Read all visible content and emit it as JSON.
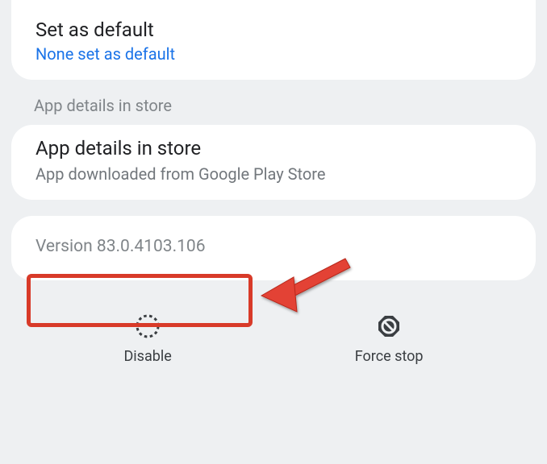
{
  "default": {
    "title": "Set as default",
    "subtitle": "None set as default"
  },
  "sectionHeader": "App details in store",
  "storeDetails": {
    "title": "App details in store",
    "subtitle": "App downloaded from Google Play Store"
  },
  "version": {
    "text": "Version 83.0.4103.106"
  },
  "actions": {
    "disable": "Disable",
    "forceStop": "Force stop"
  }
}
